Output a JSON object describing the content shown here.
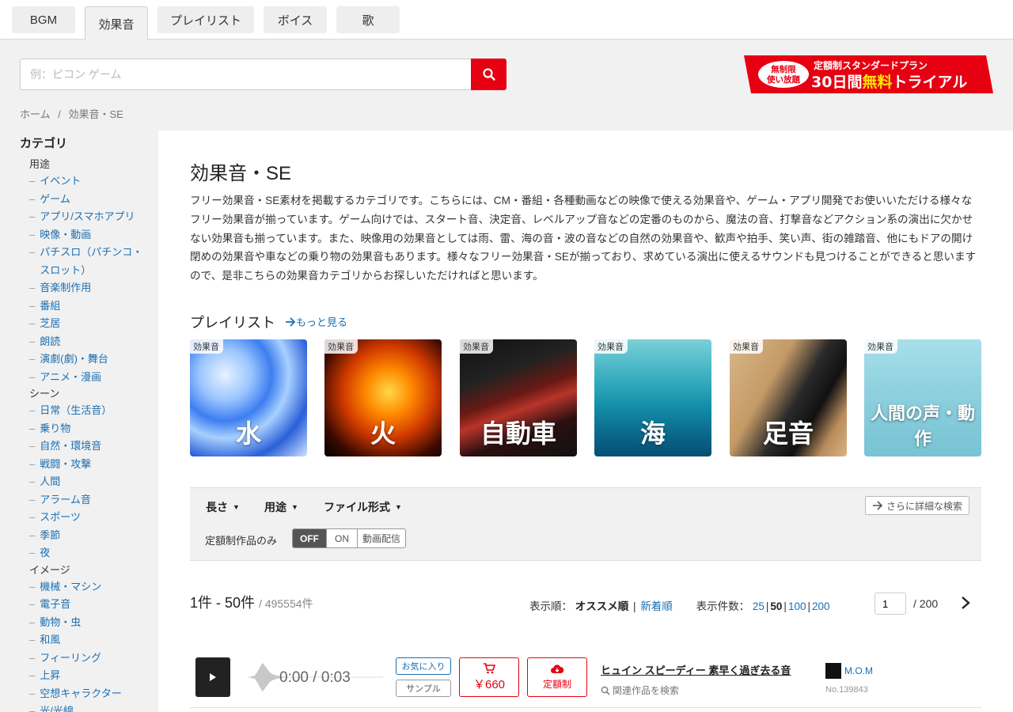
{
  "tabs": [
    "BGM",
    "効果音",
    "プレイリスト",
    "ボイス",
    "歌"
  ],
  "search": {
    "placeholder": "例：ピコン ゲーム"
  },
  "banner": {
    "badge_line1": "無制限",
    "badge_line2": "使い放題",
    "top": "定額制スタンダードプラン",
    "bottom_a": "30日間",
    "bottom_b": "無料",
    "bottom_c": "トライアル"
  },
  "breadcrumb": {
    "home": "ホーム",
    "sep": "/",
    "current": "効果音・SE"
  },
  "sidebar": {
    "title": "カテゴリ",
    "groups": [
      {
        "name": "用途",
        "items": [
          "イベント",
          "ゲーム",
          "アプリ/スマホアプリ",
          "映像・動画",
          "パチスロ（パチンコ・スロット）",
          "音楽制作用",
          "番組",
          "芝居",
          "朗読",
          "演劇(劇)・舞台",
          "アニメ・漫画"
        ]
      },
      {
        "name": "シーン",
        "items": [
          "日常（生活音）",
          "乗り物",
          "自然・環境音",
          "戦闘・攻撃",
          "人間",
          "アラーム音",
          "スポーツ",
          "季節",
          "夜"
        ]
      },
      {
        "name": "イメージ",
        "items": [
          "機械・マシン",
          "電子音",
          "動物・虫",
          "和風",
          "フィーリング",
          "上昇",
          "空想キャラクター",
          "光/光線"
        ]
      }
    ]
  },
  "main": {
    "title": "効果音・SE",
    "description": "フリー効果音・SE素材を掲載するカテゴリです。こちらには、CM・番組・各種動画などの映像で使える効果音や、ゲーム・アプリ開発でお使いいただける様々なフリー効果音が揃っています。ゲーム向けでは、スタート音、決定音、レベルアップ音などの定番のものから、魔法の音、打撃音などアクション系の演出に欠かせない効果音も揃っています。また、映像用の効果音としては雨、雷、海の音・波の音などの自然の効果音や、歓声や拍手、笑い声、街の雑踏音、他にもドアの開け閉めの効果音や車などの乗り物の効果音もあります。様々なフリー効果音・SEが揃っており、求めている演出に使えるサウンドも見つけることができると思いますので、是非こちらの効果音カテゴリからお探しいただければと思います。"
  },
  "playlists": {
    "heading": "プレイリスト",
    "more": "もっと見る",
    "items": [
      {
        "badge": "効果音",
        "title": "水"
      },
      {
        "badge": "効果音",
        "title": "火"
      },
      {
        "badge": "効果音",
        "title": "自動車"
      },
      {
        "badge": "効果音",
        "title": "海"
      },
      {
        "badge": "効果音",
        "title": "足音"
      },
      {
        "badge": "効果音",
        "title": "人間の声・動作"
      }
    ]
  },
  "filters": {
    "length": "長さ",
    "usage": "用途",
    "format": "ファイル形式",
    "advanced": "さらに詳細な検索",
    "flat_label": "定額制作品のみ",
    "toggle": [
      "OFF",
      "ON",
      "動画配信"
    ],
    "toggle_selected": "OFF"
  },
  "results": {
    "range": "1件 - 50件",
    "total": "/ 495554件",
    "sort_label": "表示順：",
    "sort_active": "オススメ順",
    "sort_other": "新着順",
    "per_page_label": "表示件数：",
    "per_page": [
      "25",
      "50",
      "100",
      "200"
    ],
    "per_page_active": "50",
    "page_current": "1",
    "page_total": "/ 200"
  },
  "track": {
    "time": "0:00 / 0:03",
    "fav": "お気に入り",
    "sample": "サンプル",
    "price": "￥660",
    "subscription": "定額制",
    "title": "ヒュイン スピーディー 素早く過ぎ去る音",
    "related": "関連作品を検索",
    "author": "M.O.M",
    "number": "No.139843"
  },
  "colors": {
    "accent_red": "#e60012",
    "link_blue": "#1a6fb3"
  }
}
